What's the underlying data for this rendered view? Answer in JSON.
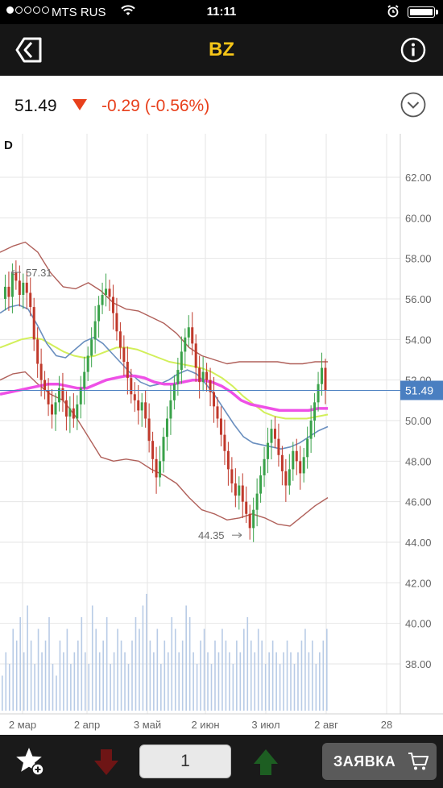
{
  "status_bar": {
    "carrier": "MTS RUS",
    "time": "11:11",
    "signal_bars_filled": 1,
    "signal_bars_total": 5
  },
  "nav": {
    "title": "BZ",
    "back_icon": "back-icon",
    "info_icon": "info-icon"
  },
  "quote": {
    "price": "51.49",
    "change": "-0.29 (-0.56%)",
    "direction": "down",
    "change_color": "#e8401c"
  },
  "chart": {
    "period_label": "D",
    "last_price_tag": "51.49",
    "max_marker": "57.31",
    "min_marker": "44.35"
  },
  "chart_data": {
    "type": "candlestick",
    "symbol": "BZ",
    "y_ticks": [
      "62.00",
      "60.00",
      "58.00",
      "56.00",
      "54.00",
      "52.00",
      "50.00",
      "48.00",
      "46.00",
      "44.00",
      "42.00",
      "40.00",
      "38.00"
    ],
    "x_ticks": [
      "2 мар",
      "2 апр",
      "3 май",
      "2 июн",
      "3 июл",
      "2 авг",
      "28"
    ],
    "ylim": [
      36.5,
      63.5
    ],
    "last_value": 51.49,
    "annotations": {
      "max": 57.31,
      "min": 44.35
    },
    "close_series": [
      56.0,
      56.6,
      56.1,
      57.3,
      56.9,
      56.2,
      56.8,
      56.3,
      55.6,
      54.0,
      52.8,
      52.0,
      51.5,
      50.8,
      50.3,
      50.9,
      51.6,
      51.0,
      50.2,
      50.6,
      50.1,
      50.8,
      51.6,
      52.4,
      53.2,
      54.0,
      54.9,
      55.7,
      56.2,
      56.5,
      56.1,
      55.3,
      54.4,
      53.6,
      52.9,
      52.1,
      51.3,
      51.0,
      50.5,
      50.9,
      50.1,
      49.0,
      48.1,
      47.2,
      48.0,
      49.2,
      50.1,
      51.0,
      51.8,
      52.5,
      53.4,
      54.1,
      54.6,
      53.8,
      52.6,
      51.9,
      52.4,
      52.0,
      51.4,
      50.7,
      50.1,
      49.3,
      48.5,
      47.6,
      46.9,
      46.3,
      46.8,
      46.0,
      45.4,
      44.7,
      45.6,
      46.4,
      47.3,
      48.1,
      48.9,
      49.6,
      49.1,
      48.3,
      47.5,
      46.8,
      47.6,
      48.5,
      48.0,
      47.4,
      48.2,
      49.1,
      50.0,
      50.9,
      51.8,
      52.6,
      51.5
    ],
    "bands_upper": [
      58.3,
      58.6,
      58.8,
      58.3,
      57.3,
      56.6,
      56.5,
      56.8,
      56.4,
      55.8,
      55.5,
      55.4,
      55.1,
      54.8,
      54.3,
      53.6,
      53.2,
      53.0,
      52.8,
      52.9,
      52.9,
      52.9,
      52.9,
      52.8,
      52.8,
      52.9,
      52.9
    ],
    "bands_lower": [
      52.0,
      52.3,
      52.4,
      51.8,
      51.3,
      51.0,
      50.2,
      49.2,
      48.2,
      48.0,
      48.1,
      48.0,
      47.6,
      47.3,
      46.9,
      46.2,
      45.6,
      45.4,
      45.1,
      45.2,
      45.4,
      45.2,
      44.9,
      44.8,
      45.3,
      45.8,
      46.2
    ],
    "ma_blue": [
      55.3,
      55.6,
      55.7,
      55.5,
      54.7,
      53.8,
      53.2,
      53.1,
      53.5,
      53.9,
      54.1,
      53.8,
      53.3,
      52.8,
      52.3,
      51.9,
      51.7,
      51.8,
      52.0,
      52.3,
      52.5,
      52.3,
      51.8,
      51.2,
      50.5,
      49.8,
      49.2,
      48.9,
      48.8,
      48.7,
      48.6,
      48.7,
      48.9,
      49.2,
      49.5,
      49.7
    ],
    "ma_green": [
      53.6,
      53.8,
      54.0,
      54.1,
      54.0,
      53.7,
      53.4,
      53.2,
      53.1,
      53.2,
      53.4,
      53.6,
      53.6,
      53.5,
      53.3,
      53.1,
      52.9,
      52.8,
      52.7,
      52.6,
      52.4,
      52.1,
      51.7,
      51.2,
      50.8,
      50.4,
      50.2,
      50.1,
      50.1,
      50.1,
      50.2,
      50.3
    ],
    "ma_pink": [
      51.3,
      51.4,
      51.5,
      51.6,
      51.7,
      51.8,
      51.8,
      51.7,
      51.6,
      51.6,
      51.8,
      52.0,
      52.1,
      52.2,
      52.2,
      52.1,
      51.9,
      51.8,
      51.8,
      51.9,
      52.0,
      52.0,
      51.9,
      51.7,
      51.4,
      51.0,
      50.8,
      50.7,
      50.6,
      50.5,
      50.5,
      50.5,
      50.5,
      50.6,
      50.6
    ],
    "volume_relative": [
      0.3,
      0.5,
      0.4,
      0.7,
      0.6,
      0.8,
      0.5,
      0.9,
      0.6,
      0.4,
      0.7,
      0.5,
      0.6,
      0.8,
      0.4,
      0.3,
      0.6,
      0.5,
      0.7,
      0.4,
      0.5,
      0.6,
      0.8,
      0.5,
      0.4,
      0.9,
      0.7,
      0.5,
      0.6,
      0.8,
      0.4,
      0.5,
      0.7,
      0.6,
      0.5,
      0.4,
      0.6,
      0.8,
      0.7,
      0.9,
      1.0,
      0.6,
      0.5,
      0.7,
      0.4,
      0.6,
      0.5,
      0.8,
      0.7,
      0.5,
      0.6,
      0.9,
      0.8,
      0.5,
      0.4,
      0.6,
      0.7,
      0.5,
      0.4,
      0.6,
      0.5,
      0.7,
      0.6,
      0.5,
      0.4,
      0.6,
      0.5,
      0.7,
      0.8,
      0.6,
      0.5,
      0.7,
      0.6,
      0.4,
      0.5,
      0.6,
      0.5,
      0.4,
      0.5,
      0.6,
      0.5,
      0.4,
      0.5,
      0.6,
      0.7,
      0.5,
      0.6,
      0.4,
      0.5,
      0.6,
      0.7
    ],
    "colors": {
      "up": "#3aa24a",
      "down": "#c0392b",
      "bands": "#b0605a",
      "ma_blue": "#6a8fbf",
      "ma_green": "#d2ef5a",
      "ma_pink": "#ee50e6",
      "last_line": "#4a7fc1",
      "volume": "#b8cbe6"
    }
  },
  "bottom_bar": {
    "quantity": "1",
    "order_label": "ЗАЯВКА"
  }
}
